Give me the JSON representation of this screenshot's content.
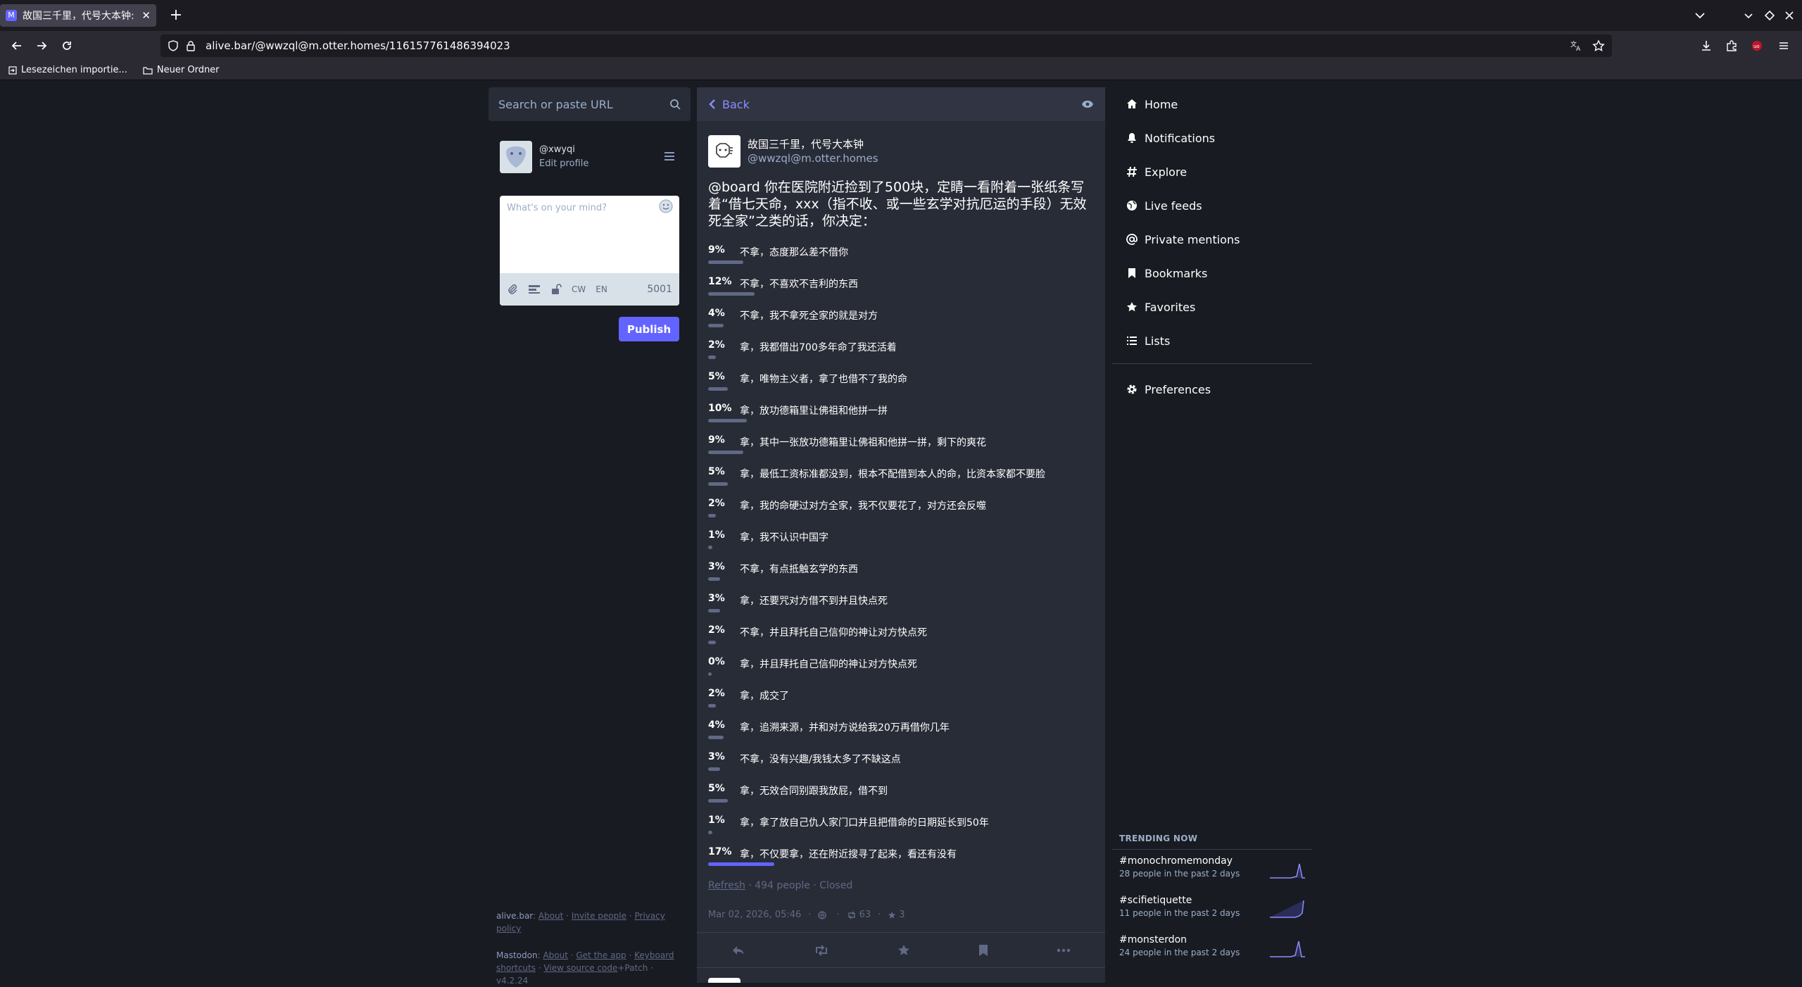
{
  "browser": {
    "tab_title": "故国三千里，代号大本钟: \"@",
    "tab_favicon": "M",
    "url": "alive.bar/@wwzql@m.otter.homes/116157761486394023",
    "bookmarks": [
      "Lesezeichen importie...",
      "Neuer Ordner"
    ]
  },
  "left": {
    "search_placeholder": "Search or paste URL",
    "account_handle": "@xwyqi",
    "edit_profile": "Edit profile",
    "compose_placeholder": "What's on your mind?",
    "tool_cw": "CW",
    "tool_lang": "EN",
    "char_count": "5001",
    "publish": "Publish",
    "footer": {
      "server": "alive.bar",
      "about": "About",
      "invite": "Invite people",
      "privacy": "Privacy policy",
      "mastodon": "Mastodon",
      "about2": "About",
      "get_app": "Get the app",
      "shortcuts": "Keyboard shortcuts",
      "source": "View source code",
      "patch": "+Patch",
      "version": "v4.2.24"
    }
  },
  "center": {
    "back": "Back",
    "author_name": "故国三千里，代号大本钟",
    "author_acct": "@wwzql@m.otter.homes",
    "mention": "@board",
    "status_text": " 你在医院附近捡到了500块，定睛一看附着一张纸条写着“借七天命，xxx（指不收、或一些玄学对抗厄运的手段）无效死全家”之类的话，你决定：",
    "poll_options": [
      {
        "pct": "9%",
        "value": 9,
        "label": "不拿，态度那么差不借你"
      },
      {
        "pct": "12%",
        "value": 12,
        "label": "不拿，不喜欢不吉利的东西"
      },
      {
        "pct": "4%",
        "value": 4,
        "label": "不拿，我不拿死全家的就是对方"
      },
      {
        "pct": "2%",
        "value": 2,
        "label": "拿，我都借出700多年命了我还活着"
      },
      {
        "pct": "5%",
        "value": 5,
        "label": "拿，唯物主义者，拿了也借不了我的命"
      },
      {
        "pct": "10%",
        "value": 10,
        "label": "拿，放功德箱里让佛祖和他拼一拼"
      },
      {
        "pct": "9%",
        "value": 9,
        "label": "拿，其中一张放功德箱里让佛祖和他拼一拼，剩下的爽花"
      },
      {
        "pct": "5%",
        "value": 5,
        "label": "拿，最低工资标准都没到，根本不配借到本人的命，比资本家都不要脸"
      },
      {
        "pct": "2%",
        "value": 2,
        "label": "拿，我的命硬过对方全家，我不仅要花了，对方还会反噬"
      },
      {
        "pct": "1%",
        "value": 1,
        "label": "拿，我不认识中国字"
      },
      {
        "pct": "3%",
        "value": 3,
        "label": "不拿，有点抵触玄学的东西"
      },
      {
        "pct": "3%",
        "value": 3,
        "label": "拿，还要咒对方借不到并且快点死"
      },
      {
        "pct": "2%",
        "value": 2,
        "label": "不拿，并且拜托自己信仰的神让对方快点死"
      },
      {
        "pct": "0%",
        "value": 0,
        "label": "拿，并且拜托自己信仰的神让对方快点死"
      },
      {
        "pct": "2%",
        "value": 2,
        "label": "拿，成交了"
      },
      {
        "pct": "4%",
        "value": 4,
        "label": "拿，追溯来源，并和对方说给我20万再借你几年"
      },
      {
        "pct": "3%",
        "value": 3,
        "label": "不拿，没有兴趣/我钱太多了不缺这点"
      },
      {
        "pct": "5%",
        "value": 5,
        "label": "拿，无效合同别跟我放屁，借不到"
      },
      {
        "pct": "1%",
        "value": 1,
        "label": "拿，拿了放自己仇人家门口并且把借命的日期延长到50年"
      },
      {
        "pct": "17%",
        "value": 17,
        "label": "拿，不仅要拿，还在附近搜寻了起来，看还有没有"
      }
    ],
    "poll_refresh": "Refresh",
    "poll_summary": " · 494 people · Closed",
    "timestamp": "Mar 02, 2026, 05:46",
    "meta_sep": "·",
    "reblogs": "63",
    "favourites": "3"
  },
  "nav": {
    "items": [
      {
        "label": "Home",
        "icon": "home-icon"
      },
      {
        "label": "Notifications",
        "icon": "bell-icon"
      },
      {
        "label": "Explore",
        "icon": "hashtag-icon"
      },
      {
        "label": "Live feeds",
        "icon": "globe-icon"
      },
      {
        "label": "Private mentions",
        "icon": "at-icon"
      },
      {
        "label": "Bookmarks",
        "icon": "bookmark-icon"
      },
      {
        "label": "Favorites",
        "icon": "star-icon"
      },
      {
        "label": "Lists",
        "icon": "list-icon"
      }
    ],
    "preferences": "Preferences"
  },
  "trending": {
    "title": "TRENDING NOW",
    "items": [
      {
        "tag": "#monochromemonday",
        "uses": "28 people in the past 2 days"
      },
      {
        "tag": "#scifietiquette",
        "uses": "11 people in the past 2 days"
      },
      {
        "tag": "#monsterdon",
        "uses": "24 people in the past 2 days"
      }
    ]
  },
  "colors": {
    "accent": "#6364ff",
    "link": "#8c8dff",
    "background": "#191b22",
    "column": "#282c37"
  }
}
